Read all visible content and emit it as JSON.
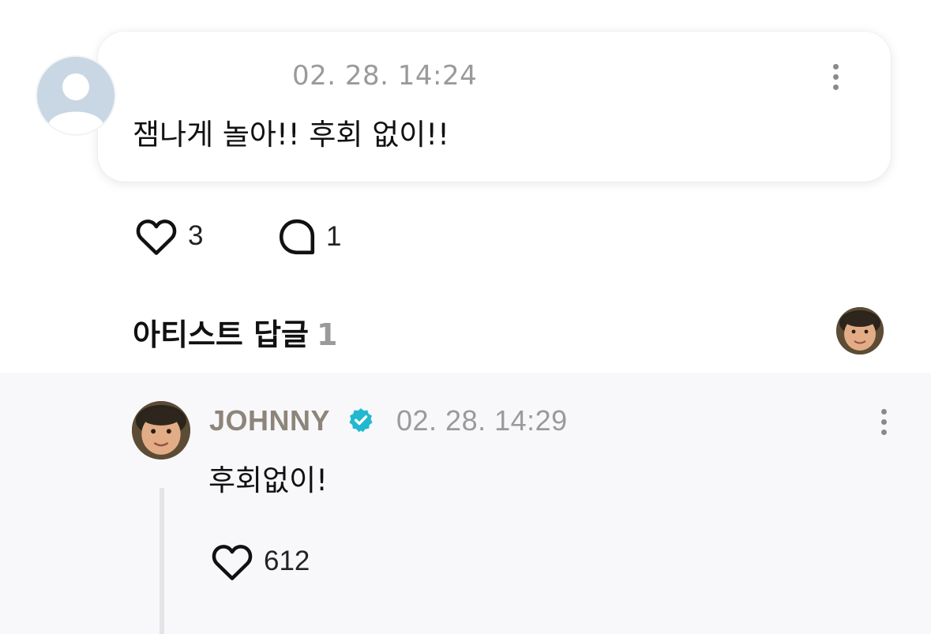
{
  "fan_comment": {
    "timestamp": "02. 28. 14:24",
    "text": "잼나게 놀아!! 후회 없이!!",
    "like_count": "3",
    "reply_count": "1",
    "avatar": "default-user-avatar"
  },
  "artist_replies": {
    "title": "아티스트 답글",
    "count": "1"
  },
  "reply": {
    "author": "JOHNNY",
    "verified": true,
    "timestamp": "02. 28. 14:29",
    "text": "후회없이!",
    "like_count": "612"
  },
  "colors": {
    "verified_badge": "#22b8cf",
    "author_name": "#8e857a",
    "muted_text": "#9a9a9a",
    "reply_background": "#f8f8fb"
  },
  "icons": {
    "like": "heart-icon",
    "comment": "comment-bubble-icon",
    "more": "more-vertical-icon",
    "verified": "verified-badge-icon"
  }
}
